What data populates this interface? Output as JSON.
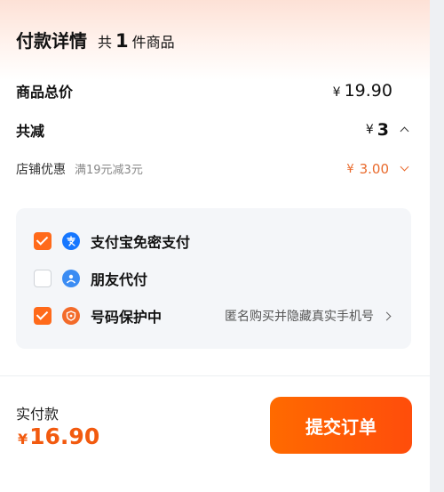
{
  "header": {
    "title": "付款详情",
    "count_prefix": "共",
    "count": "1",
    "count_suffix": "件商品"
  },
  "summary": {
    "goods_total_label": "商品总价",
    "goods_total_currency": "¥",
    "goods_total_value": "19.90",
    "discount_label": "共减",
    "discount_currency": "¥",
    "discount_value": "3",
    "store_discount_label": "店铺优惠",
    "store_discount_desc": "满19元减3元",
    "store_discount_currency": "¥",
    "store_discount_value": "3.00"
  },
  "options": [
    {
      "label": "支付宝免密支付",
      "checked": true,
      "icon": "alipay-icon"
    },
    {
      "label": "朋友代付",
      "checked": false,
      "icon": "friend-pay-icon"
    },
    {
      "label": "号码保护中",
      "checked": true,
      "icon": "phone-protect-icon",
      "note": "匿名购买并隐藏真实手机号"
    }
  ],
  "footer": {
    "total_label": "实付款",
    "total_currency": "¥",
    "total_value": "16.90",
    "submit_label": "提交订单"
  },
  "colors": {
    "accent": "#ff6a1a",
    "price_orange": "#e96a2c",
    "alipay_blue": "#1677ff",
    "friend_blue": "#3b8cf3",
    "protect_orange": "#f36b2a"
  }
}
